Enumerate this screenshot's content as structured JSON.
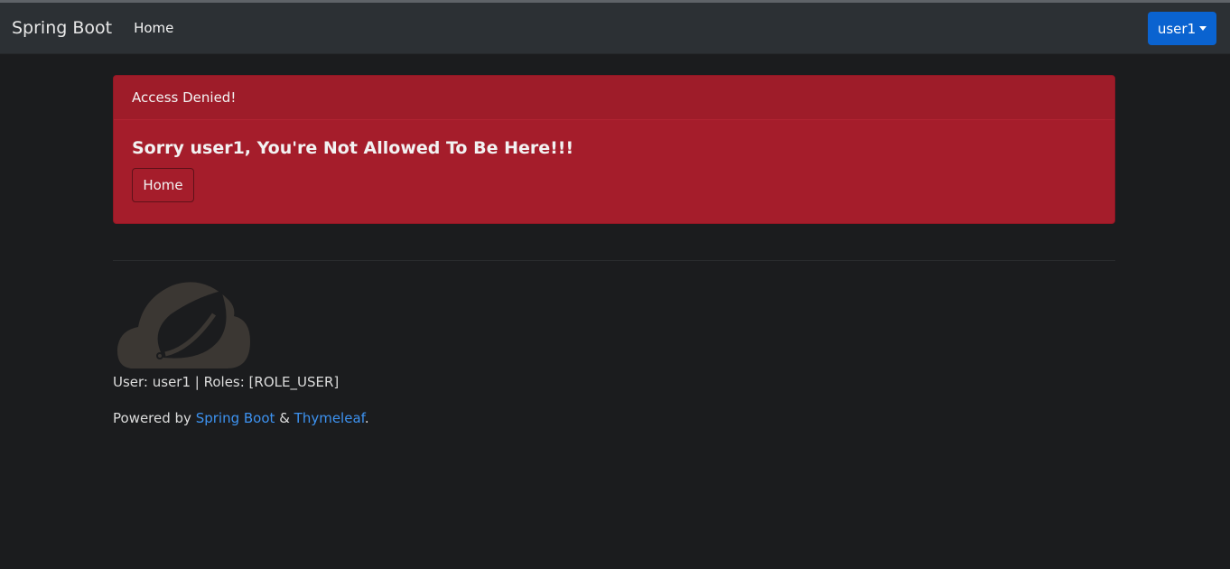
{
  "navbar": {
    "brand": "Spring Boot",
    "home_link": "Home",
    "user_menu_label": "user1"
  },
  "alert": {
    "header": "Access Denied!",
    "title": "Sorry user1, You're Not Allowed To Be Here!!!",
    "button_label": "Home"
  },
  "footer": {
    "user_info": "User: user1 | Roles: [ROLE_USER]",
    "powered_prefix": "Powered by ",
    "spring_link": "Spring Boot",
    "ampersand": " & ",
    "thymeleaf_link": "Thymeleaf",
    "period": "."
  },
  "colors": {
    "background": "#1b1c1e",
    "navbar": "#2c3034",
    "alert": "#a51d2b",
    "primary": "#0a63d0",
    "link": "#3d92f0"
  },
  "icons": {
    "logo": "spring-leaf-logo"
  }
}
